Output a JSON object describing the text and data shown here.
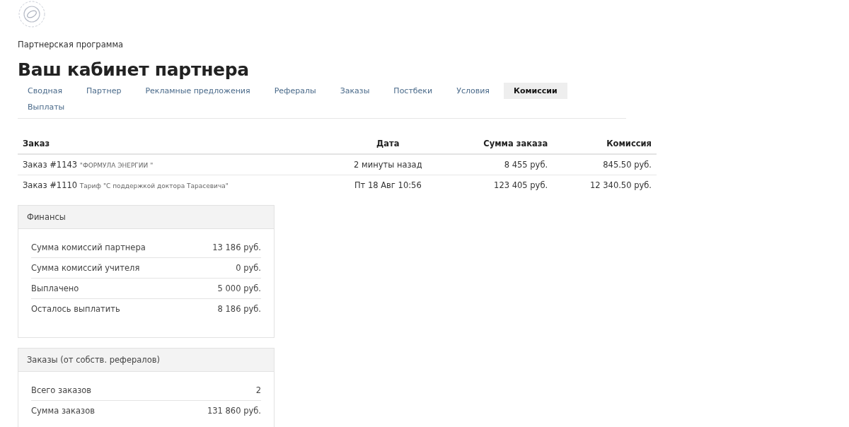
{
  "breadcrumb": "Партнерская программа",
  "title": "Ваш кабинет партнера",
  "tabs": [
    {
      "label": "Сводная",
      "selected": false
    },
    {
      "label": "Партнер",
      "selected": false
    },
    {
      "label": "Рекламные предложения",
      "selected": false
    },
    {
      "label": "Рефералы",
      "selected": false
    },
    {
      "label": "Заказы",
      "selected": false
    },
    {
      "label": "Постбеки",
      "selected": false
    },
    {
      "label": "Условия",
      "selected": false
    },
    {
      "label": "Комиссии",
      "selected": true
    },
    {
      "label": "Выплаты",
      "selected": false
    }
  ],
  "table": {
    "columns": [
      "Заказ",
      "Дата",
      "Сумма заказа",
      "Комиссия"
    ],
    "rows": [
      {
        "order": "Заказ #1143",
        "product": "\"ФОРМУЛА ЭНЕРГИИ \"",
        "date": "2 минуты назад",
        "amount": "8 455 руб.",
        "commission": "845.50 руб."
      },
      {
        "order": "Заказ #1110",
        "product": "Тариф \"С поддержкой доктора Тарасевича\"",
        "date": "Пт 18 Авг 10:56",
        "amount": "123 405 руб.",
        "commission": "12 340.50 руб."
      }
    ]
  },
  "panels": [
    {
      "title": "Финансы",
      "rows": [
        {
          "label": "Сумма комиссий партнера",
          "value": "13 186 руб."
        },
        {
          "label": "Сумма комиссий учителя",
          "value": "0 руб."
        },
        {
          "label": "Выплачено",
          "value": "5 000 руб."
        },
        {
          "label": "Осталось выплатить",
          "value": "8 186 руб."
        }
      ]
    },
    {
      "title": "Заказы (от собств. рефералов)",
      "rows": [
        {
          "label": "Всего заказов",
          "value": "2"
        },
        {
          "label": "Сумма заказов",
          "value": "131 860 руб."
        }
      ]
    }
  ]
}
